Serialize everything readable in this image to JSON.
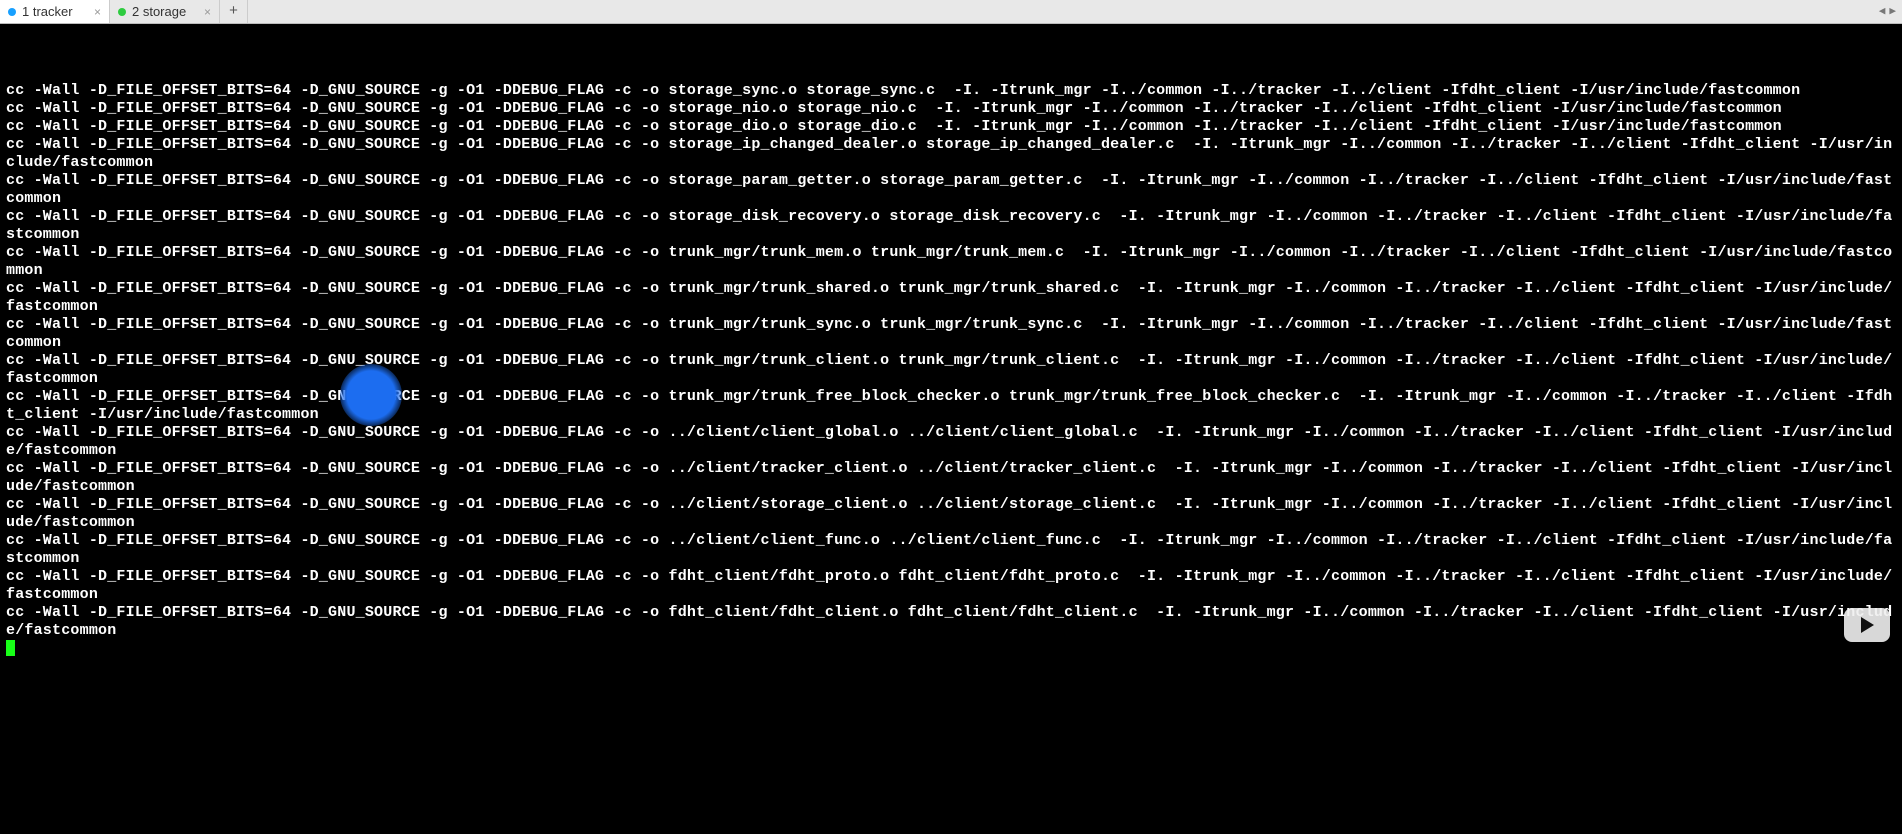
{
  "tabs": [
    {
      "label": "1 tracker",
      "dot": "blue",
      "active": true
    },
    {
      "label": "2 storage",
      "dot": "green",
      "active": false
    }
  ],
  "new_tab_label": "+",
  "nav_left": "◀",
  "nav_right": "▶",
  "close_glyph": "×",
  "terminal_lines": [
    "cc -Wall -D_FILE_OFFSET_BITS=64 -D_GNU_SOURCE -g -O1 -DDEBUG_FLAG -c -o storage_sync.o storage_sync.c  -I. -Itrunk_mgr -I../common -I../tracker -I../client -Ifdht_client -I/usr/include/fastcommon",
    "cc -Wall -D_FILE_OFFSET_BITS=64 -D_GNU_SOURCE -g -O1 -DDEBUG_FLAG -c -o storage_nio.o storage_nio.c  -I. -Itrunk_mgr -I../common -I../tracker -I../client -Ifdht_client -I/usr/include/fastcommon",
    "cc -Wall -D_FILE_OFFSET_BITS=64 -D_GNU_SOURCE -g -O1 -DDEBUG_FLAG -c -o storage_dio.o storage_dio.c  -I. -Itrunk_mgr -I../common -I../tracker -I../client -Ifdht_client -I/usr/include/fastcommon",
    "cc -Wall -D_FILE_OFFSET_BITS=64 -D_GNU_SOURCE -g -O1 -DDEBUG_FLAG -c -o storage_ip_changed_dealer.o storage_ip_changed_dealer.c  -I. -Itrunk_mgr -I../common -I../tracker -I../client -Ifdht_client -I/usr/include/fastcommon",
    "cc -Wall -D_FILE_OFFSET_BITS=64 -D_GNU_SOURCE -g -O1 -DDEBUG_FLAG -c -o storage_param_getter.o storage_param_getter.c  -I. -Itrunk_mgr -I../common -I../tracker -I../client -Ifdht_client -I/usr/include/fastcommon",
    "cc -Wall -D_FILE_OFFSET_BITS=64 -D_GNU_SOURCE -g -O1 -DDEBUG_FLAG -c -o storage_disk_recovery.o storage_disk_recovery.c  -I. -Itrunk_mgr -I../common -I../tracker -I../client -Ifdht_client -I/usr/include/fastcommon",
    "cc -Wall -D_FILE_OFFSET_BITS=64 -D_GNU_SOURCE -g -O1 -DDEBUG_FLAG -c -o trunk_mgr/trunk_mem.o trunk_mgr/trunk_mem.c  -I. -Itrunk_mgr -I../common -I../tracker -I../client -Ifdht_client -I/usr/include/fastcommon",
    "cc -Wall -D_FILE_OFFSET_BITS=64 -D_GNU_SOURCE -g -O1 -DDEBUG_FLAG -c -o trunk_mgr/trunk_shared.o trunk_mgr/trunk_shared.c  -I. -Itrunk_mgr -I../common -I../tracker -I../client -Ifdht_client -I/usr/include/fastcommon",
    "cc -Wall -D_FILE_OFFSET_BITS=64 -D_GNU_SOURCE -g -O1 -DDEBUG_FLAG -c -o trunk_mgr/trunk_sync.o trunk_mgr/trunk_sync.c  -I. -Itrunk_mgr -I../common -I../tracker -I../client -Ifdht_client -I/usr/include/fastcommon",
    "cc -Wall -D_FILE_OFFSET_BITS=64 -D_GNU_SOURCE -g -O1 -DDEBUG_FLAG -c -o trunk_mgr/trunk_client.o trunk_mgr/trunk_client.c  -I. -Itrunk_mgr -I../common -I../tracker -I../client -Ifdht_client -I/usr/include/fastcommon",
    "cc -Wall -D_FILE_OFFSET_BITS=64 -D_GNU_SOURCE -g -O1 -DDEBUG_FLAG -c -o trunk_mgr/trunk_free_block_checker.o trunk_mgr/trunk_free_block_checker.c  -I. -Itrunk_mgr -I../common -I../tracker -I../client -Ifdht_client -I/usr/include/fastcommon",
    "cc -Wall -D_FILE_OFFSET_BITS=64 -D_GNU_SOURCE -g -O1 -DDEBUG_FLAG -c -o ../client/client_global.o ../client/client_global.c  -I. -Itrunk_mgr -I../common -I../tracker -I../client -Ifdht_client -I/usr/include/fastcommon",
    "cc -Wall -D_FILE_OFFSET_BITS=64 -D_GNU_SOURCE -g -O1 -DDEBUG_FLAG -c -o ../client/tracker_client.o ../client/tracker_client.c  -I. -Itrunk_mgr -I../common -I../tracker -I../client -Ifdht_client -I/usr/include/fastcommon",
    "cc -Wall -D_FILE_OFFSET_BITS=64 -D_GNU_SOURCE -g -O1 -DDEBUG_FLAG -c -o ../client/storage_client.o ../client/storage_client.c  -I. -Itrunk_mgr -I../common -I../tracker -I../client -Ifdht_client -I/usr/include/fastcommon",
    "cc -Wall -D_FILE_OFFSET_BITS=64 -D_GNU_SOURCE -g -O1 -DDEBUG_FLAG -c -o ../client/client_func.o ../client/client_func.c  -I. -Itrunk_mgr -I../common -I../tracker -I../client -Ifdht_client -I/usr/include/fastcommon",
    "cc -Wall -D_FILE_OFFSET_BITS=64 -D_GNU_SOURCE -g -O1 -DDEBUG_FLAG -c -o fdht_client/fdht_proto.o fdht_client/fdht_proto.c  -I. -Itrunk_mgr -I../common -I../tracker -I../client -Ifdht_client -I/usr/include/fastcommon",
    "cc -Wall -D_FILE_OFFSET_BITS=64 -D_GNU_SOURCE -g -O1 -DDEBUG_FLAG -c -o fdht_client/fdht_client.o fdht_client/fdht_client.c  -I. -Itrunk_mgr -I../common -I../tracker -I../client -Ifdht_client -I/usr/include/fastcommon"
  ]
}
